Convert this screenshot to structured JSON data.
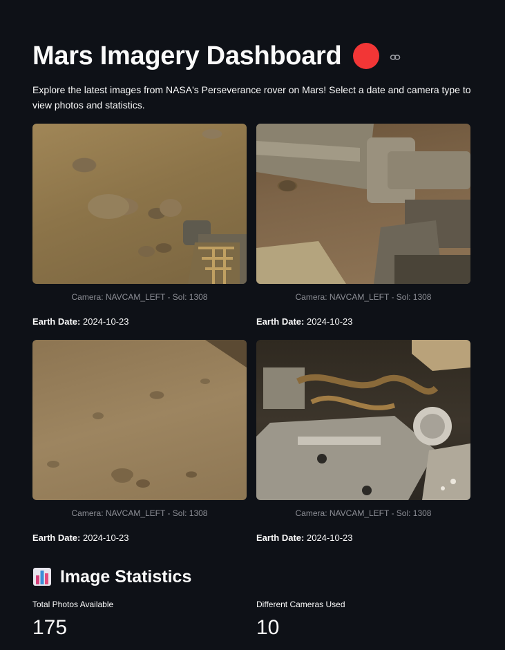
{
  "header": {
    "title": "Mars Imagery Dashboard",
    "intro": "Explore the latest images from NASA's Perseverance rover on Mars! Select a date and camera type to view photos and statistics."
  },
  "photos": [
    {
      "caption": "Camera: NAVCAM_LEFT - Sol: 1308",
      "earth_date_label": "Earth Date:",
      "earth_date": "2024-10-23"
    },
    {
      "caption": "Camera: NAVCAM_LEFT - Sol: 1308",
      "earth_date_label": "Earth Date:",
      "earth_date": "2024-10-23"
    },
    {
      "caption": "Camera: NAVCAM_LEFT - Sol: 1308",
      "earth_date_label": "Earth Date:",
      "earth_date": "2024-10-23"
    },
    {
      "caption": "Camera: NAVCAM_LEFT - Sol: 1308",
      "earth_date_label": "Earth Date:",
      "earth_date": "2024-10-23"
    }
  ],
  "stats": {
    "icon": "bar-chart-icon",
    "title": "Image Statistics",
    "metrics": [
      {
        "label": "Total Photos Available",
        "value": "175"
      },
      {
        "label": "Different Cameras Used",
        "value": "10"
      }
    ]
  },
  "colors": {
    "background": "#0e1117",
    "accent_dot": "#f23636",
    "caption": "#8d8f96"
  }
}
